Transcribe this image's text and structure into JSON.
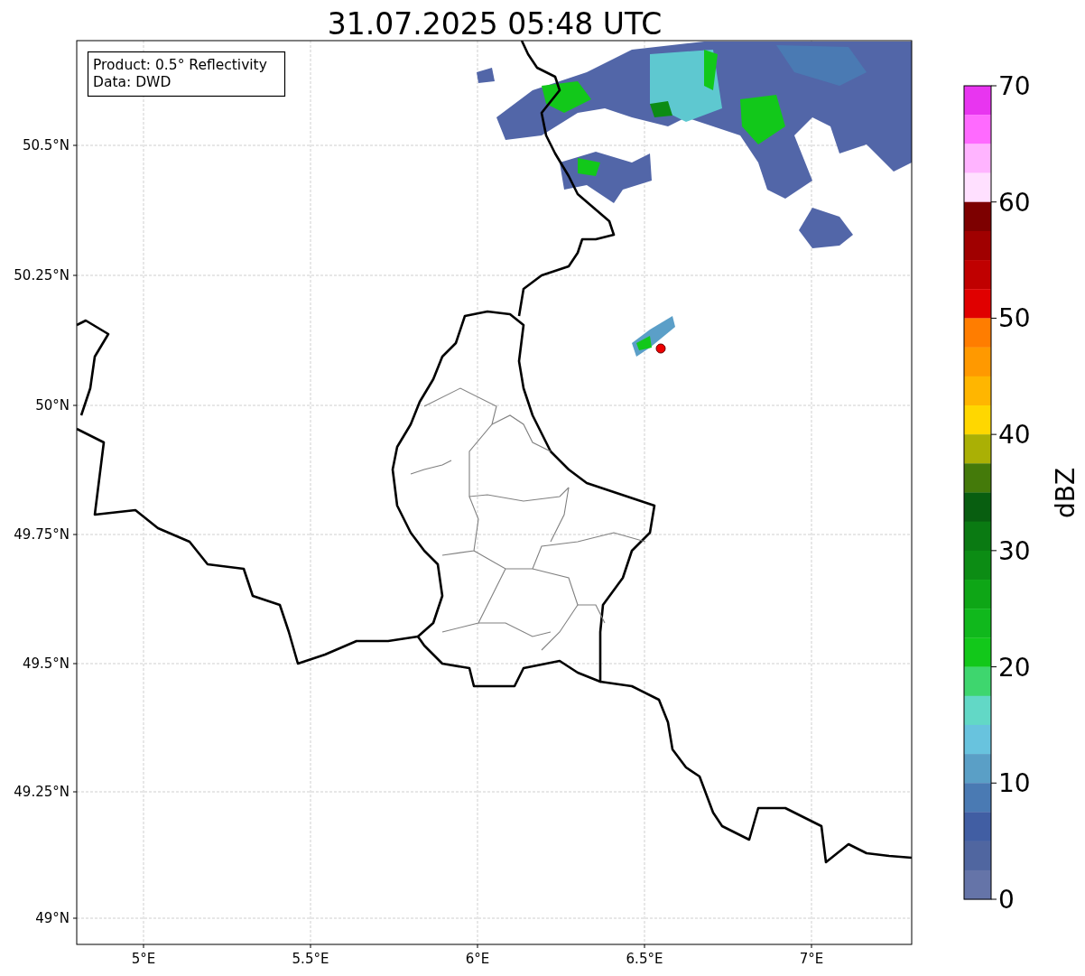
{
  "title": "31.07.2025 05:48 UTC",
  "info_box": {
    "lines": [
      "Product: 0.5° Reflectivity",
      "Data: DWD"
    ]
  },
  "map": {
    "y_ticks": [
      "50.5°N",
      "50.25°N",
      "50°N",
      "49.75°N",
      "49.5°N",
      "49.25°N",
      "49°N"
    ],
    "x_ticks": [
      "5°E",
      "5.5°E",
      "6°E",
      "6.5°E",
      "7°E"
    ]
  },
  "colorbar": {
    "label": "dBZ",
    "ticks": [
      "70",
      "60",
      "50",
      "40",
      "30",
      "20",
      "10",
      "0"
    ],
    "bins": [
      {
        "color": "#e835f0"
      },
      {
        "color": "#ff6aff"
      },
      {
        "color": "#ffb4ff"
      },
      {
        "color": "#ffe0ff"
      },
      {
        "color": "#7d0000"
      },
      {
        "color": "#a00000"
      },
      {
        "color": "#c00000"
      },
      {
        "color": "#e00000"
      },
      {
        "color": "#ff7d00"
      },
      {
        "color": "#ff9900"
      },
      {
        "color": "#ffb600"
      },
      {
        "color": "#ffd700"
      },
      {
        "color": "#aab005"
      },
      {
        "color": "#447a0a"
      },
      {
        "color": "#085e10"
      },
      {
        "color": "#0a7a12"
      },
      {
        "color": "#0c8c14"
      },
      {
        "color": "#0ea616"
      },
      {
        "color": "#10b81c"
      },
      {
        "color": "#12c81a"
      },
      {
        "color": "#3ed66e"
      },
      {
        "color": "#62d8c6"
      },
      {
        "color": "#68c3de"
      },
      {
        "color": "#5a9fc6"
      },
      {
        "color": "#4a7ab3"
      },
      {
        "color": "#415ea3"
      },
      {
        "color": "#5066a0"
      },
      {
        "color": "#6574a8"
      }
    ]
  }
}
